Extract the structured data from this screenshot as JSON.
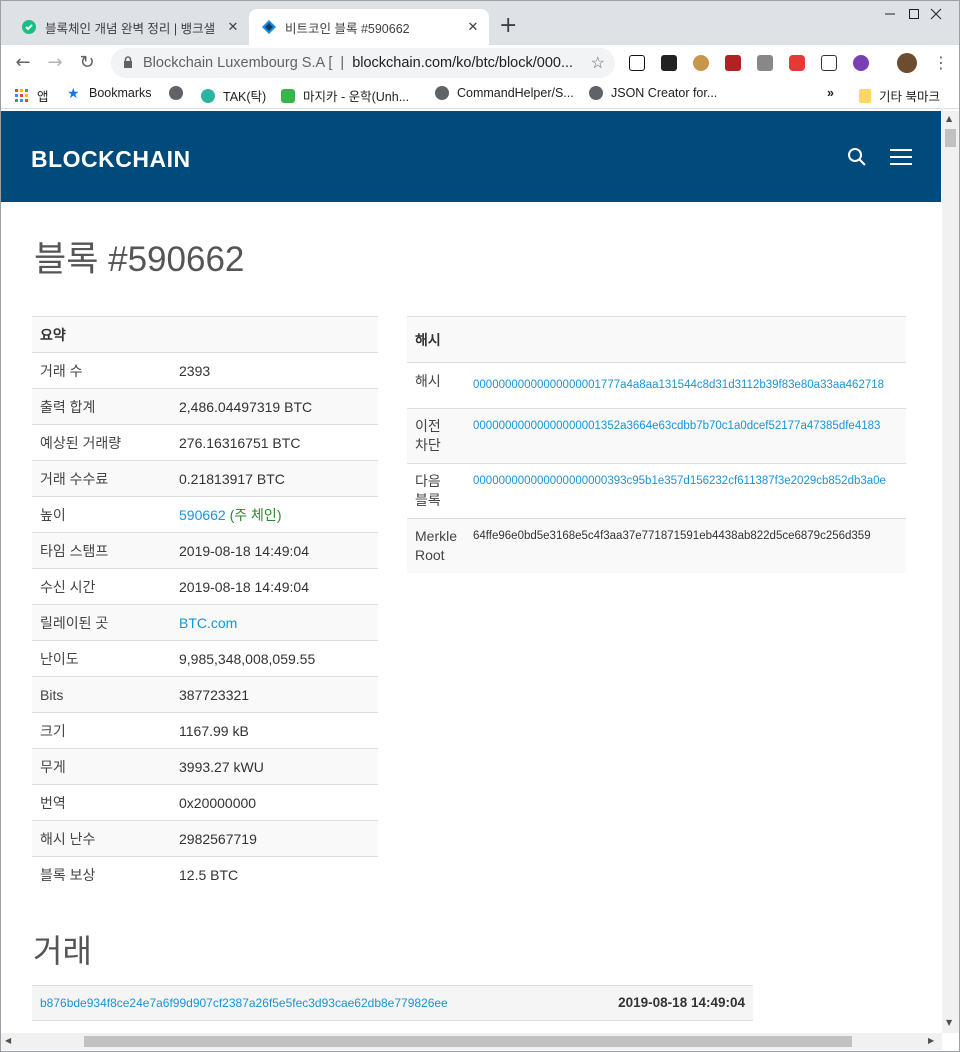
{
  "browser": {
    "tabs": [
      {
        "title": "블록체인 개념 완벽 정리 | 뱅크샐",
        "close": "✕"
      },
      {
        "title": "비트코인 블록 #590662",
        "close": "✕"
      }
    ],
    "new_tab": "+",
    "window_controls": {
      "minimize": "—",
      "maximize": "☐",
      "close": "✕"
    },
    "nav": {
      "back": "←",
      "forward": "→",
      "reload": "↻"
    },
    "omnibox": {
      "org": "Blockchain Luxembourg S.A [",
      "separator": "|",
      "url": "blockchain.com/ko/btc/block/000..."
    },
    "bookmarks": [
      {
        "label": "앱"
      },
      {
        "label": "Bookmarks"
      },
      {
        "label": ""
      },
      {
        "label": "TAK(탁)"
      },
      {
        "label": "마지카 - 운학(Unh..."
      },
      {
        "label": "CommandHelper/S..."
      },
      {
        "label": "JSON Creator for..."
      },
      {
        "label": "»"
      },
      {
        "label": "기타 북마크"
      }
    ]
  },
  "site": {
    "logo": "BLOCKCHAIN",
    "colors": {
      "header_bg": "#004a7c",
      "link": "#1a94d6",
      "main_chain": "#2a8a2a"
    }
  },
  "page": {
    "title": "블록 #590662",
    "summary": {
      "header": "요약",
      "rows": [
        {
          "k": "거래 수",
          "v": "2393"
        },
        {
          "k": "출력 합계",
          "v": "2,486.04497319 BTC"
        },
        {
          "k": "예상된 거래량",
          "v": "276.16316751 BTC"
        },
        {
          "k": "거래 수수료",
          "v": "0.21813917 BTC"
        },
        {
          "k": "높이",
          "v": "590662",
          "extra_open": " (",
          "extra": "주 체인",
          "extra_close": ")"
        },
        {
          "k": "타임 스탬프",
          "v": "2019-08-18 14:49:04"
        },
        {
          "k": "수신 시간",
          "v": "2019-08-18 14:49:04"
        },
        {
          "k": "릴레이된 곳",
          "v": "BTC.com"
        },
        {
          "k": "난이도",
          "v": "9,985,348,008,059.55"
        },
        {
          "k": "Bits",
          "v": "387723321"
        },
        {
          "k": "크기",
          "v": "1167.99 kB"
        },
        {
          "k": "무게",
          "v": "3993.27 kWU"
        },
        {
          "k": "번역",
          "v": "0x20000000"
        },
        {
          "k": "해시 난수",
          "v": "2982567719"
        },
        {
          "k": "블록 보상",
          "v": "12.5 BTC"
        }
      ]
    },
    "hashes": {
      "header": "해시",
      "rows": [
        {
          "k": "해시",
          "v": "00000000000000000001777a4a8aa131544c8d31d3112b39f83e80a33aa462718"
        },
        {
          "k": "이전 차단",
          "v": "00000000000000000001352a3664e63cdbb7b70c1a0dcef52177a47385dfe4183"
        },
        {
          "k": "다음 블록",
          "v": "000000000000000000000393c95b1e357d156232cf611387f3e2029cb852db3a0e"
        },
        {
          "k": "Merkle Root",
          "v": "64ffe96e0bd5e3168e5c4f3aa37e771871591eb4438ab822d5ce6879c256d359"
        }
      ]
    },
    "transactions": {
      "title": "거래",
      "rows": [
        {
          "hash": "b876bde934f8ce24e7a6f99d907cf2387a26f5e5fec3d93cae62db8e779826ee",
          "time": "2019-08-18 14:49:04"
        }
      ]
    }
  }
}
